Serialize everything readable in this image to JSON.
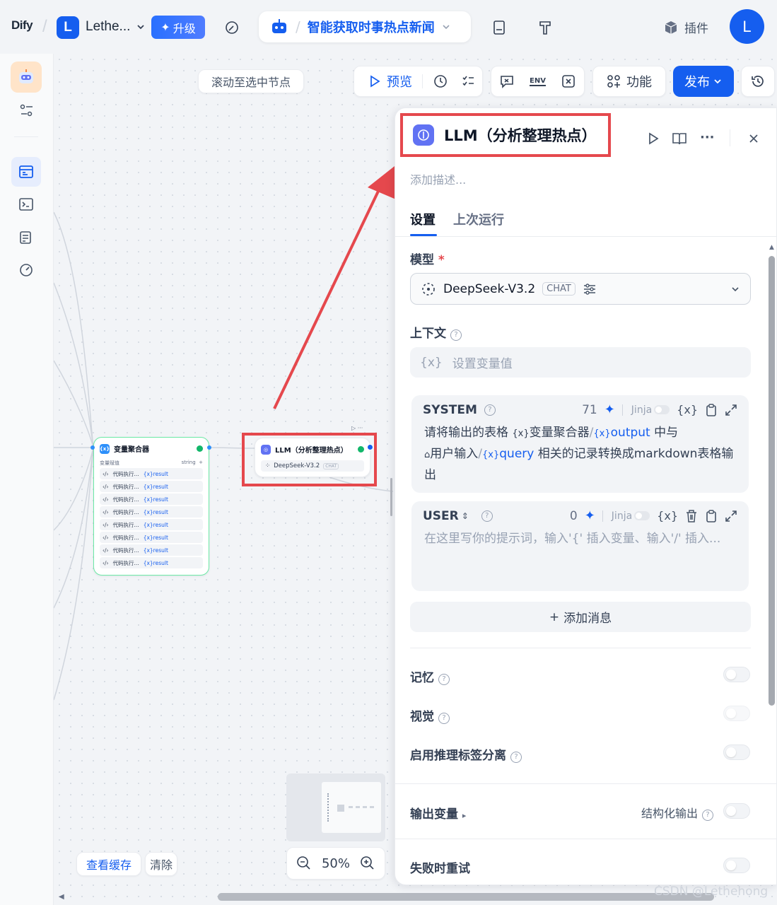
{
  "topbar": {
    "logo": "Dify",
    "workspace_initial": "L",
    "workspace_name": "Lethe...",
    "upgrade_label": "升级",
    "app_title": "智能获取时事热点新闻",
    "plugins_label": "插件",
    "user_initial": "L"
  },
  "canvas": {
    "scroll_tip": "滚动至选中节点",
    "preview_label": "预览",
    "env_label": "ENV",
    "features_label": "功能",
    "publish_label": "发布",
    "zoom": "50%",
    "view_cache_label": "查看缓存",
    "clear_label": "清除",
    "accent_color": "#155eef"
  },
  "nodes": {
    "aggregator": {
      "title": "变量聚合器",
      "sub_left": "变量赋值",
      "sub_right": "string",
      "rows": [
        {
          "src": "代码执行...",
          "var": "result"
        },
        {
          "src": "代码执行...",
          "var": "result"
        },
        {
          "src": "代码执行...",
          "var": "result"
        },
        {
          "src": "代码执行...",
          "var": "result"
        },
        {
          "src": "代码执行...",
          "var": "result"
        },
        {
          "src": "代码执行...",
          "var": "result"
        },
        {
          "src": "代码执行...",
          "var": "result"
        },
        {
          "src": "代码执行...",
          "var": "result"
        }
      ]
    },
    "llm": {
      "title": "LLM（分析整理热点）",
      "model": "DeepSeek-V3.2",
      "badge": "CHAT"
    }
  },
  "panel": {
    "title": "LLM（分析整理热点）",
    "desc_placeholder": "添加描述...",
    "tabs": [
      "设置",
      "上次运行"
    ],
    "model_label": "模型",
    "required_mark": "*",
    "model_name": "DeepSeek-V3.2",
    "model_badge": "CHAT",
    "context_label": "上下文",
    "context_placeholder": "设置变量值",
    "system": {
      "role": "SYSTEM",
      "tokens": "71",
      "jinja": "Jinja",
      "text_1": "请将输出的表格",
      "chip_1": "变量聚合器",
      "chip_1_var": "output",
      "text_2": "中与",
      "chip_2": "用户输入",
      "chip_2_var": "query",
      "text_3": "相关的记录转换成markdown表格输出"
    },
    "user": {
      "role": "USER",
      "tokens": "0",
      "jinja": "Jinja",
      "placeholder": "在这里写你的提示词，输入'{' 插入变量、输入'/' 插入..."
    },
    "add_message_label": "添加消息",
    "memory_label": "记忆",
    "vision_label": "视觉",
    "reasoning_label": "启用推理标签分离",
    "output_vars_label": "输出变量",
    "structured_output_label": "结构化输出",
    "retry_label": "失败时重试"
  },
  "watermark": "CSDN @Lethehong"
}
